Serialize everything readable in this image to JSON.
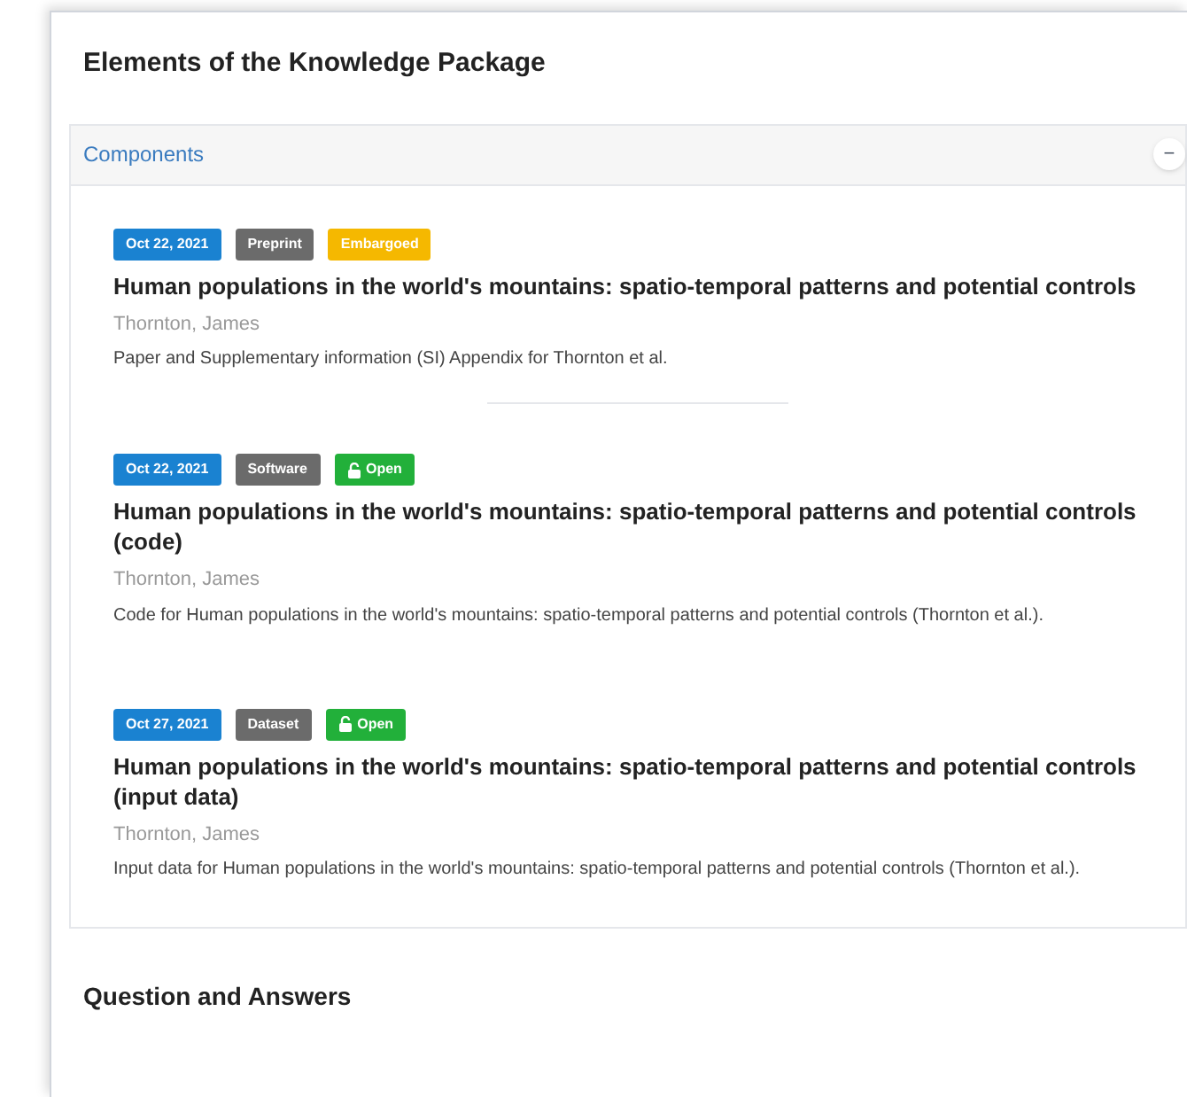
{
  "title": "Elements of the Knowledge Package",
  "panel": {
    "heading": "Components",
    "collapse_symbol": "−",
    "items": [
      {
        "badges": [
          {
            "kind": "date",
            "label": "Oct 22, 2021",
            "color": "#1a82d1"
          },
          {
            "kind": "type",
            "label": "Preprint",
            "color": "#6b6b6b"
          },
          {
            "kind": "access",
            "label": "Embargoed",
            "color": "#f5b800"
          }
        ],
        "title": "Human populations in the world's mountains: spatio-temporal patterns and potential controls",
        "author": "Thornton, James",
        "description": "Paper and Supplementary information (SI) Appendix for Thornton et al."
      },
      {
        "badges": [
          {
            "kind": "date",
            "label": "Oct 22, 2021",
            "color": "#1a82d1"
          },
          {
            "kind": "type",
            "label": "Software",
            "color": "#6b6b6b"
          },
          {
            "kind": "open",
            "label": "Open",
            "color": "#22b03a"
          }
        ],
        "title": "Human populations in the world's mountains: spatio-temporal patterns and potential controls (code)",
        "author": "Thornton, James",
        "description": "Code for Human populations in the world's mountains: spatio-temporal patterns and potential controls (Thornton et al.)."
      },
      {
        "badges": [
          {
            "kind": "date",
            "label": "Oct 27, 2021",
            "color": "#1a82d1"
          },
          {
            "kind": "type",
            "label": "Dataset",
            "color": "#6b6b6b"
          },
          {
            "kind": "open",
            "label": "Open",
            "color": "#22b03a"
          }
        ],
        "title": "Human populations in the world's mountains: spatio-temporal patterns and potential controls (input data)",
        "author": "Thornton, James",
        "description": "Input data for Human populations in the world's mountains: spatio-temporal patterns and potential controls (Thornton et al.)."
      }
    ]
  },
  "next_section": "Question and Answers"
}
